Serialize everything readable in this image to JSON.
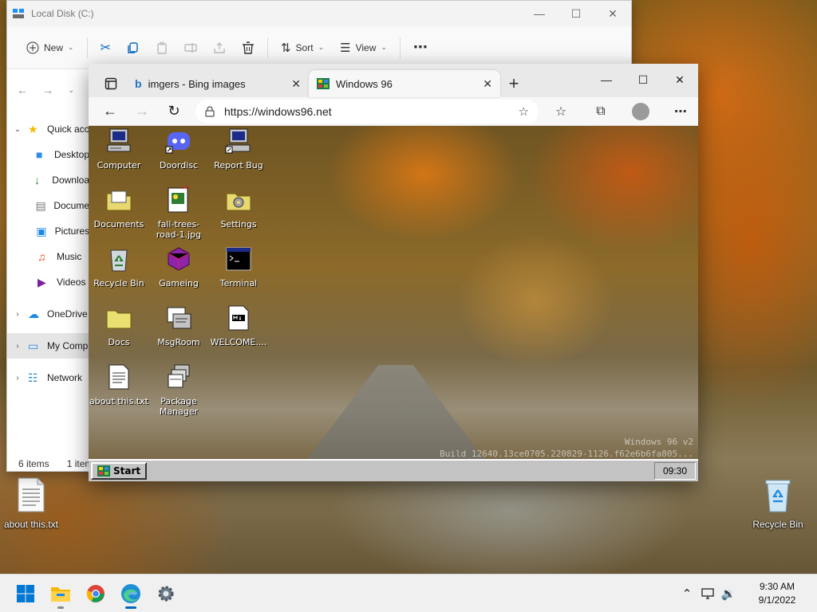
{
  "desktop": {
    "icons": {
      "about": "about this.txt",
      "recycle": "Recycle Bin"
    }
  },
  "explorer": {
    "title": "Local Disk (C:)",
    "toolbar": {
      "new": "New",
      "sort": "Sort",
      "view": "View"
    },
    "sidebar": [
      {
        "label": "Quick acc",
        "icon": "star-icon"
      },
      {
        "label": "Desktop",
        "icon": "desktop-folder-icon"
      },
      {
        "label": "Downloa",
        "icon": "download-icon"
      },
      {
        "label": "Docume",
        "icon": "documents-icon"
      },
      {
        "label": "Pictures",
        "icon": "pictures-icon"
      },
      {
        "label": "Music",
        "icon": "music-icon"
      },
      {
        "label": "Videos",
        "icon": "videos-icon"
      },
      {
        "label": "OneDrive",
        "icon": "cloud-icon"
      },
      {
        "label": "My Comp",
        "icon": "computer-icon"
      },
      {
        "label": "Network",
        "icon": "network-icon"
      }
    ],
    "status": {
      "items": "6 items",
      "selected": "1 item"
    }
  },
  "browser": {
    "tabs": [
      {
        "title": "imgers - Bing images"
      },
      {
        "title": "Windows 96"
      }
    ],
    "url": "https://windows96.net",
    "page": {
      "icons": [
        {
          "label": "Computer"
        },
        {
          "label": "Doordisc"
        },
        {
          "label": "Report Bug"
        },
        {
          "label": "Documents"
        },
        {
          "label": "fall-trees-road-1.jpg"
        },
        {
          "label": "Settings"
        },
        {
          "label": "Recycle Bin"
        },
        {
          "label": "Gameing"
        },
        {
          "label": "Terminal"
        },
        {
          "label": "Docs"
        },
        {
          "label": "MsgRoom"
        },
        {
          "label": "WELCOME...."
        },
        {
          "label": "about this.txt"
        },
        {
          "label": "Package Manager"
        }
      ],
      "watermark_line1": "Windows 96 v2",
      "watermark_line2": "Build 12640.13ce0705.220829-1126.f62e6b6fa805...",
      "start": "Start",
      "clock": "09:30"
    }
  },
  "taskbar": {
    "time": "9:30 AM",
    "date": "9/1/2022"
  },
  "colors": {
    "accent": "#0067c0",
    "win96_gray": "#c3c3c3"
  }
}
